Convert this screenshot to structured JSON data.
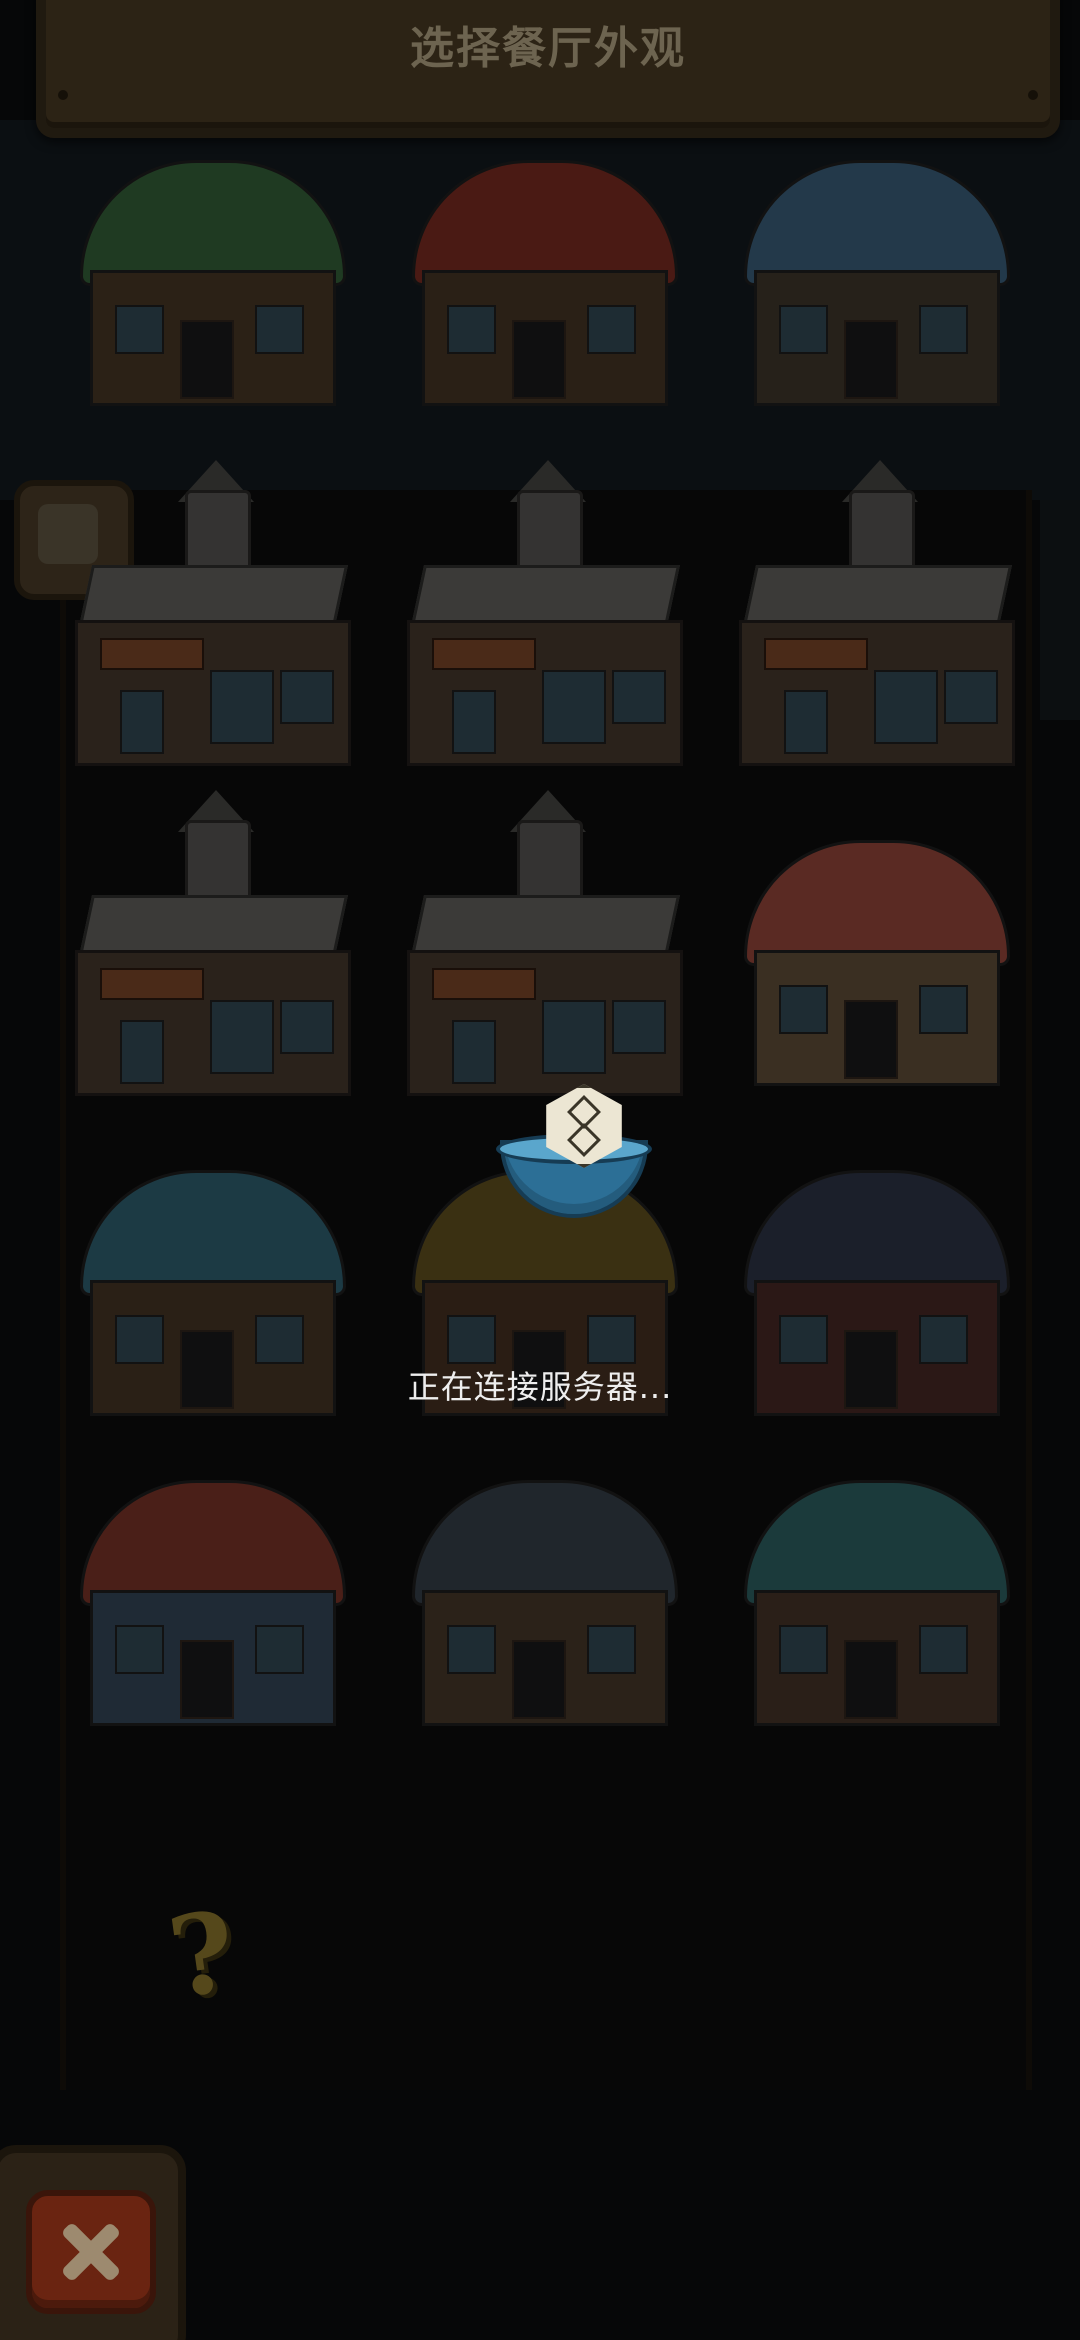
{
  "header": {
    "title": "选择餐厅外观"
  },
  "status": {
    "loading_text": "正在连接服务器..."
  },
  "grid": {
    "tiles": [
      {
        "name": "restaurant-skin-green-roof-chicken",
        "style": "house",
        "roof_color": "#1f3a22",
        "body_color": "#2b2116"
      },
      {
        "name": "restaurant-skin-red-roof-chicken",
        "style": "house",
        "roof_color": "#4a1a14",
        "body_color": "#2a2016"
      },
      {
        "name": "restaurant-skin-blue-roof-chicken",
        "style": "house",
        "roof_color": "#23394a",
        "body_color": "#26211a"
      },
      {
        "name": "restaurant-skin-stone-1",
        "style": "stone"
      },
      {
        "name": "restaurant-skin-stone-2",
        "style": "stone"
      },
      {
        "name": "restaurant-skin-stone-3",
        "style": "stone"
      },
      {
        "name": "restaurant-skin-stone-4",
        "style": "stone"
      },
      {
        "name": "restaurant-skin-stone-5",
        "style": "stone"
      },
      {
        "name": "restaurant-skin-rabbit-temple",
        "style": "house",
        "roof_color": "#5a2a23",
        "body_color": "#3a2f22"
      },
      {
        "name": "restaurant-skin-blue-barrel",
        "style": "house",
        "roof_color": "#1c3a44",
        "body_color": "#2a2016"
      },
      {
        "name": "restaurant-skin-yellow-tower",
        "style": "house",
        "roof_color": "#3a3012",
        "body_color": "#2a1d14"
      },
      {
        "name": "restaurant-skin-japanese-shop",
        "style": "house",
        "roof_color": "#1b1f2a",
        "body_color": "#2b1816"
      },
      {
        "name": "restaurant-skin-octopus",
        "style": "house",
        "roof_color": "#4a1f18",
        "body_color": "#1f2a35"
      },
      {
        "name": "restaurant-skin-grill",
        "style": "house",
        "roof_color": "#20262c",
        "body_color": "#2b2219"
      },
      {
        "name": "restaurant-skin-fish-mouth",
        "style": "house",
        "roof_color": "#1b3a3b",
        "body_color": "#2a1f18"
      }
    ]
  },
  "placeholder": {
    "mark": "?"
  }
}
